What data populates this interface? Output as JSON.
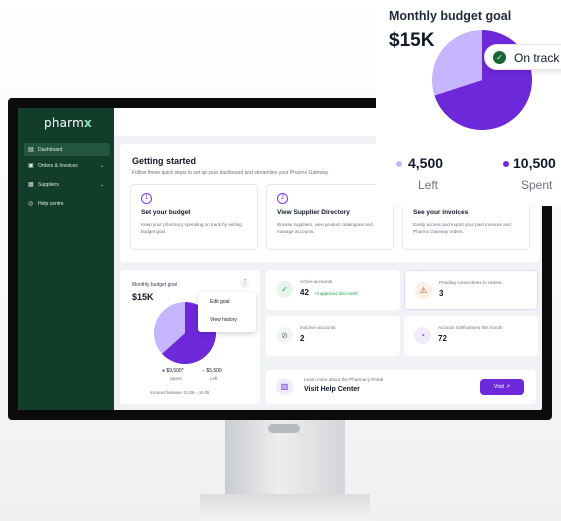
{
  "brand": {
    "logo": "pharm",
    "logo_mark": "x"
  },
  "sidebar": {
    "items": [
      {
        "label": "Dashboard",
        "icon": "dashboard-icon",
        "active": true
      },
      {
        "label": "Orders & Invoices",
        "icon": "orders-icon",
        "caret": "⌄"
      },
      {
        "label": "Suppliers",
        "icon": "suppliers-icon",
        "caret": "⌄"
      },
      {
        "label": "Help centre",
        "icon": "help-icon"
      }
    ]
  },
  "getting_started": {
    "title": "Getting started",
    "subtitle": "Follow these quick steps to set up your dashboard and streamline your Pharmx Gateway",
    "steps": [
      {
        "num": "1",
        "title": "Set your budget",
        "desc": "Keep your pharmacy spending on track by setting budget goal."
      },
      {
        "num": "2",
        "title": "View Supplier Directory",
        "desc": "Browse suppliers, view product catalogues and manage accounts."
      },
      {
        "num": "3",
        "title": "See your invoices",
        "desc": "Easily access and export your past invoices and Pharmx Gateway orders."
      }
    ]
  },
  "budget_card": {
    "title": "Monthly budget goal",
    "amount": "$15K",
    "menu": [
      "Edit goal",
      "View history"
    ],
    "legend": [
      {
        "value": "$9,500*",
        "label": "Spent",
        "color": "#6d28d9"
      },
      {
        "value": "$5,500",
        "label": "Left",
        "color": "#c4b5fd"
      }
    ],
    "note": "Invoiced between 01.05 – 16.05"
  },
  "stats": [
    {
      "label": "Active accounts",
      "value": "42",
      "delta": "+3 approved this month",
      "icon": "user-check-icon",
      "tone": "green"
    },
    {
      "label": "Pending connections to review",
      "value": "3",
      "icon": "warning-icon",
      "tone": "orange"
    },
    {
      "label": "Inactive accounts",
      "value": "2",
      "icon": "user-off-icon",
      "tone": "gray"
    },
    {
      "label": "Account notifications this month",
      "value": "72",
      "icon": "bell-icon",
      "tone": "purple"
    }
  ],
  "help": {
    "subtitle": "Learn more about the Pharmacy Portal",
    "title": "Visit Help Center",
    "button": "Visit",
    "icon": "book-icon"
  },
  "overlay": {
    "title": "Monthly budget goal",
    "amount": "$15K",
    "badge": "On track",
    "left_value": "4,500",
    "left_label": "Left",
    "spent_value": "10,500",
    "spent_label": "Spent"
  },
  "colors": {
    "sidebar": "#123d2b",
    "accent": "#6d28d9",
    "accent_light": "#c4b5fd",
    "success": "#166534"
  },
  "chart_data": [
    {
      "type": "pie",
      "title": "Monthly budget goal",
      "categories": [
        "Spent",
        "Left"
      ],
      "values": [
        10500,
        4500
      ],
      "colors": [
        "#6d28d9",
        "#c4b5fd"
      ]
    },
    {
      "type": "pie",
      "title": "Monthly budget goal",
      "categories": [
        "Spent",
        "Left"
      ],
      "values": [
        9500,
        5500
      ],
      "colors": [
        "#6d28d9",
        "#c4b5fd"
      ]
    }
  ]
}
